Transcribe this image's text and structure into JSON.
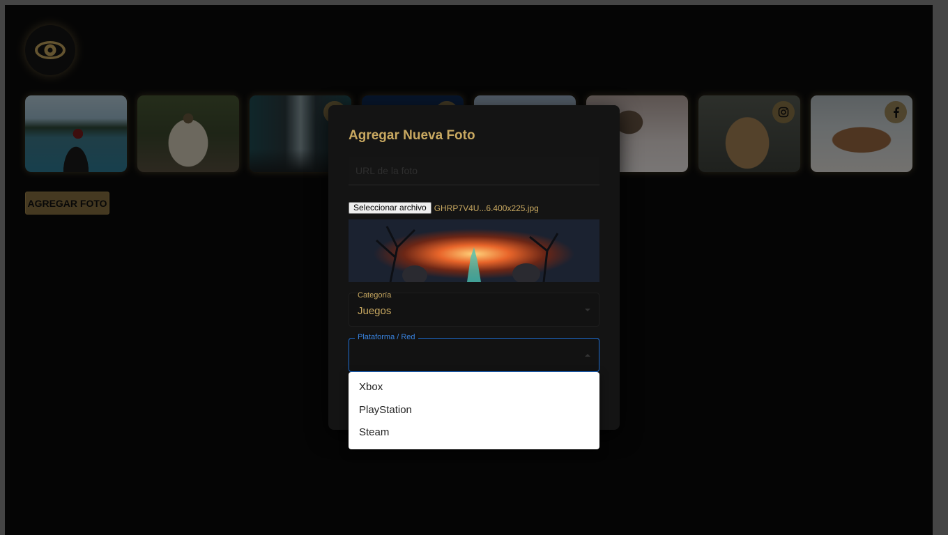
{
  "modal": {
    "title": "Agregar Nueva Foto",
    "url_placeholder": "URL de la foto",
    "file_button": "Seleccionar archivo",
    "file_name": "GHRP7V4U...6.400x225.jpg",
    "category_label": "Categoría",
    "category_value": "Juegos",
    "platform_label": "Plataforma / Red"
  },
  "platform_options": [
    "Xbox",
    "PlayStation",
    "Steam"
  ],
  "add_button": "AGREGAR FOTO",
  "gallery": [
    {
      "subject": "woman-in-canoe",
      "badge": null
    },
    {
      "subject": "pug-in-blanket",
      "badge": null
    },
    {
      "subject": "subway-station",
      "badge": "instagram"
    },
    {
      "subject": "starry-night",
      "badge": "instagram"
    },
    {
      "subject": "snowy-landscape",
      "badge": null
    },
    {
      "subject": "pug-in-bed",
      "badge": null
    },
    {
      "subject": "lioness",
      "badge": "instagram"
    },
    {
      "subject": "walruses",
      "badge": "facebook"
    }
  ],
  "colors": {
    "accent": "#c9a961",
    "background": "#0b0b0b",
    "focus": "#1e6fd6"
  }
}
